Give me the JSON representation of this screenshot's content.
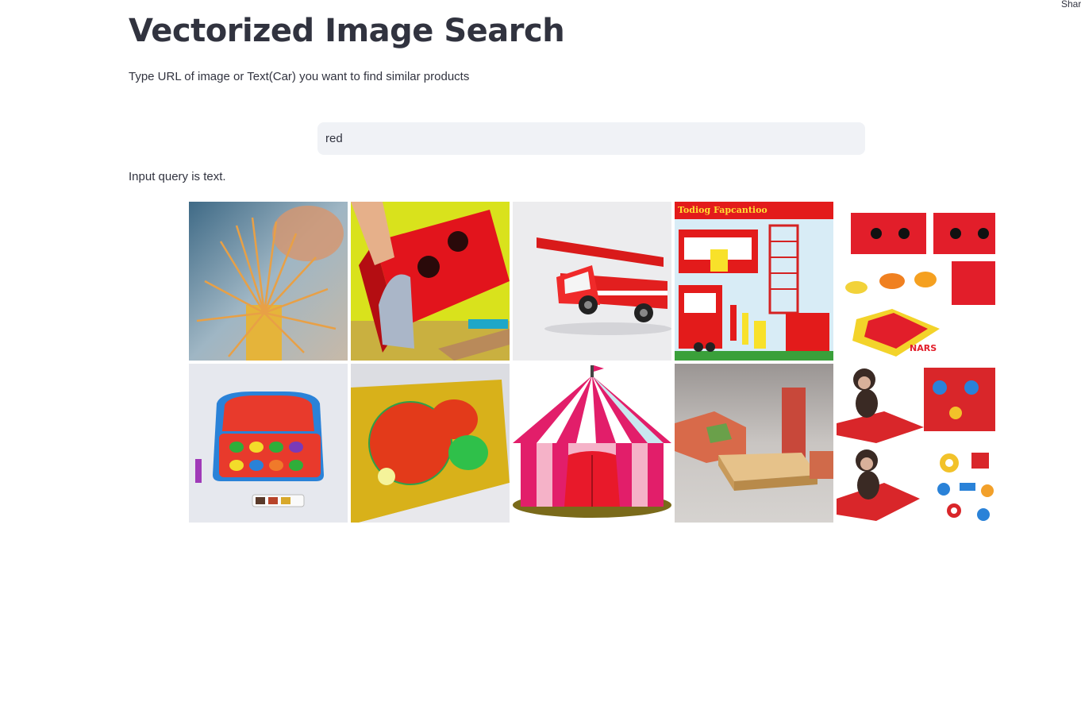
{
  "header": {
    "share_label": "Share"
  },
  "main": {
    "title": "Vectorized Image Search",
    "subtitle": "Type URL of image or Text(Car) you want to find similar products",
    "search": {
      "value": "red",
      "placeholder": ""
    },
    "query_status": "Input query is text."
  },
  "results": {
    "images": [
      {
        "name": "orange-sticks-toy-image"
      },
      {
        "name": "red-tunnel-box-image"
      },
      {
        "name": "red-fire-truck-image"
      },
      {
        "name": "fire-station-illustration-image",
        "caption": "Todiog Fapcantioo"
      },
      {
        "name": "red-board-game-set-image",
        "caption": "NARS"
      },
      {
        "name": "play-dough-case-image"
      },
      {
        "name": "ping-pong-board-image"
      },
      {
        "name": "circus-tent-image"
      },
      {
        "name": "wooden-blocks-image"
      },
      {
        "name": "monkey-toy-set-image"
      }
    ]
  },
  "colors": {
    "text": "#31333f",
    "input_bg": "#f0f2f6"
  }
}
